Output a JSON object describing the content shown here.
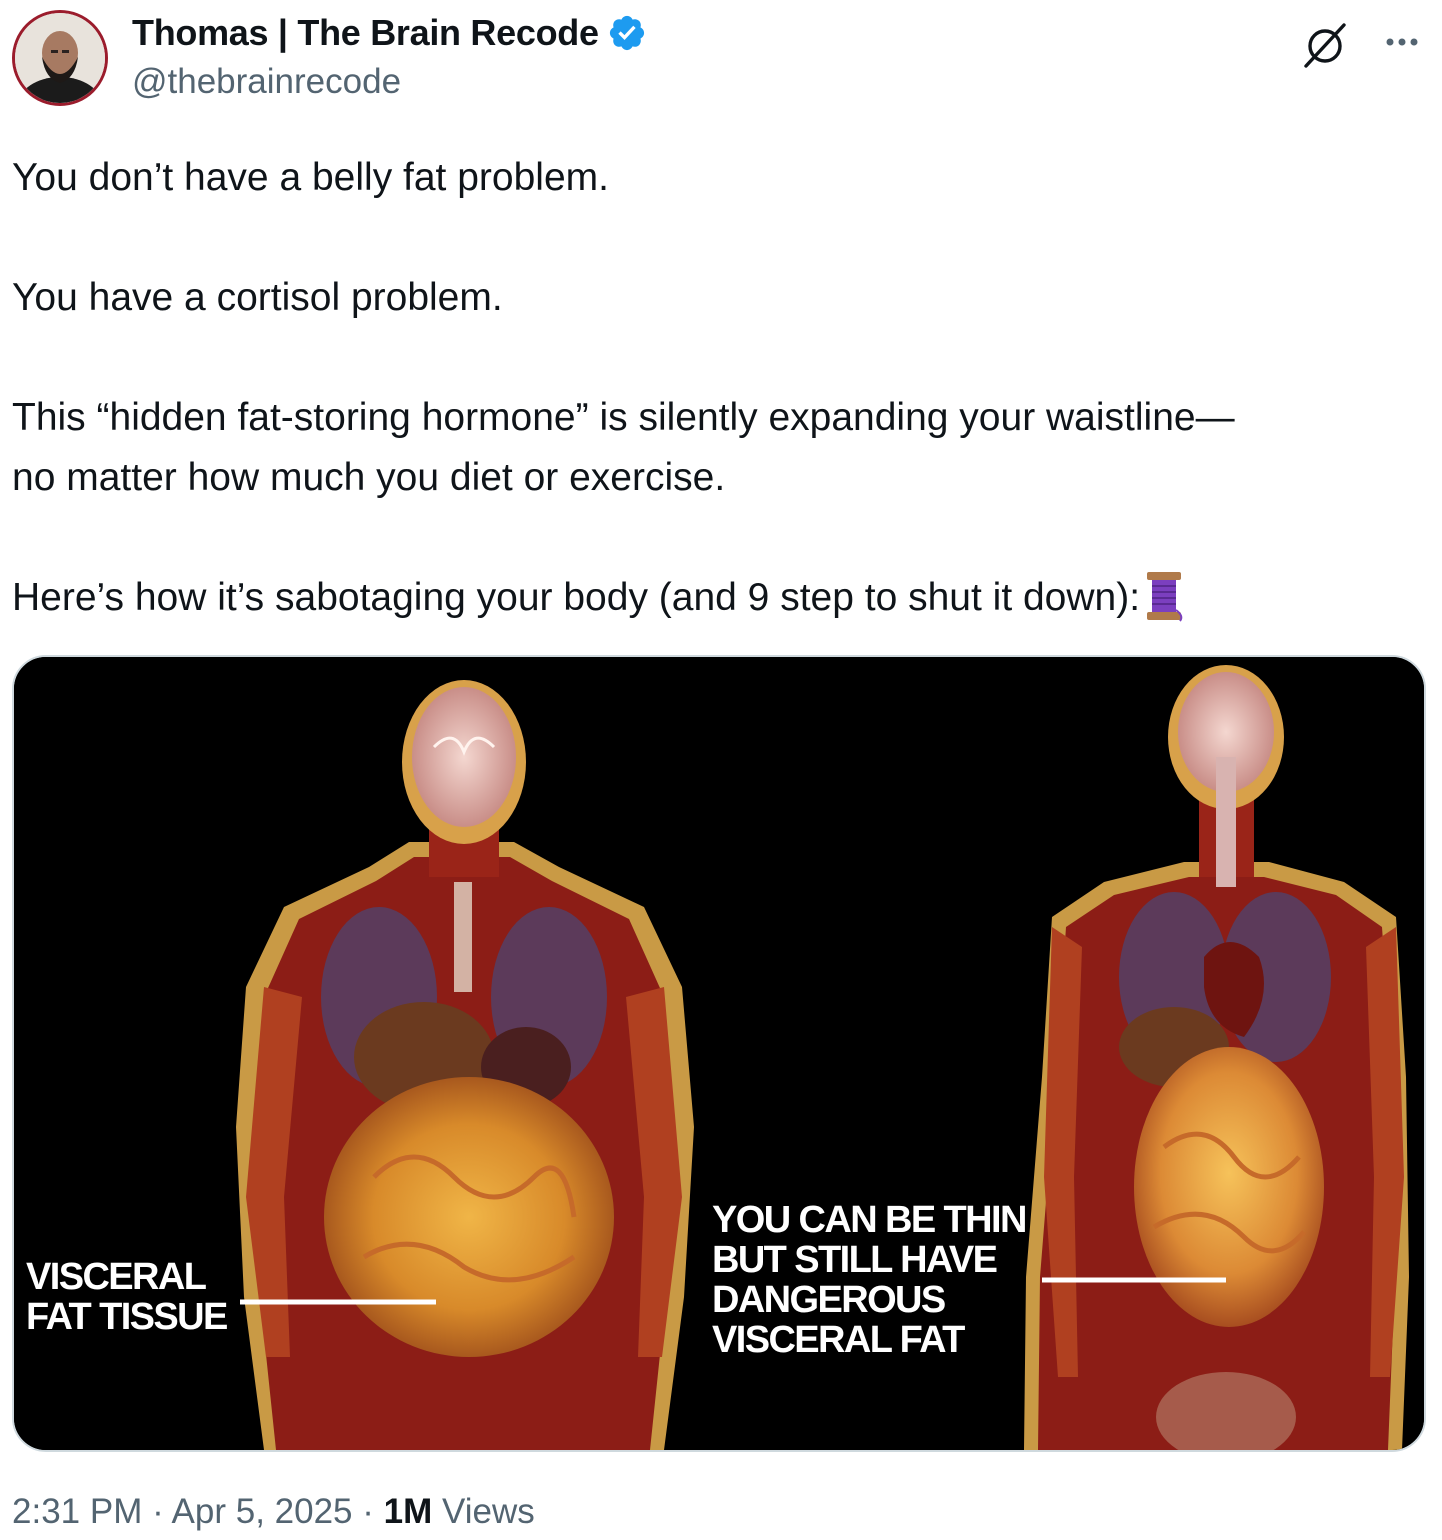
{
  "author": {
    "display_name": "Thomas | The Brain Recode",
    "handle": "@thebrainrecode",
    "verified": true
  },
  "icons": {
    "avatar": "profile-photo-avatar",
    "verified": "verified-badge-icon",
    "grok": "grok-icon",
    "more": "more-options-icon",
    "spool": "thread-spool-emoji"
  },
  "tweet": {
    "paragraphs": [
      "You don’t have a belly fat problem.",
      "You have a cortisol problem.",
      "This “hidden fat-storing hormone” is silently expanding your waistline—",
      "no matter how much you diet or exercise.",
      "Here’s how it’s sabotaging your body (and 9 step to shut it down):"
    ]
  },
  "media": {
    "label_left": "VISCERAL\nFAT TISSUE",
    "label_right": "YOU CAN BE THIN\nBUT STILL HAVE\nDANGEROUS\nVISCERAL FAT"
  },
  "meta": {
    "time": "2:31 PM",
    "separator": "·",
    "date": "Apr 5, 2025",
    "views_count": "1M",
    "views_label": "Views"
  },
  "colors": {
    "verified": "#1d9bf0",
    "secondary_text": "#536471",
    "primary_text": "#0f1419",
    "avatar_ring": "#9b1c2c"
  }
}
